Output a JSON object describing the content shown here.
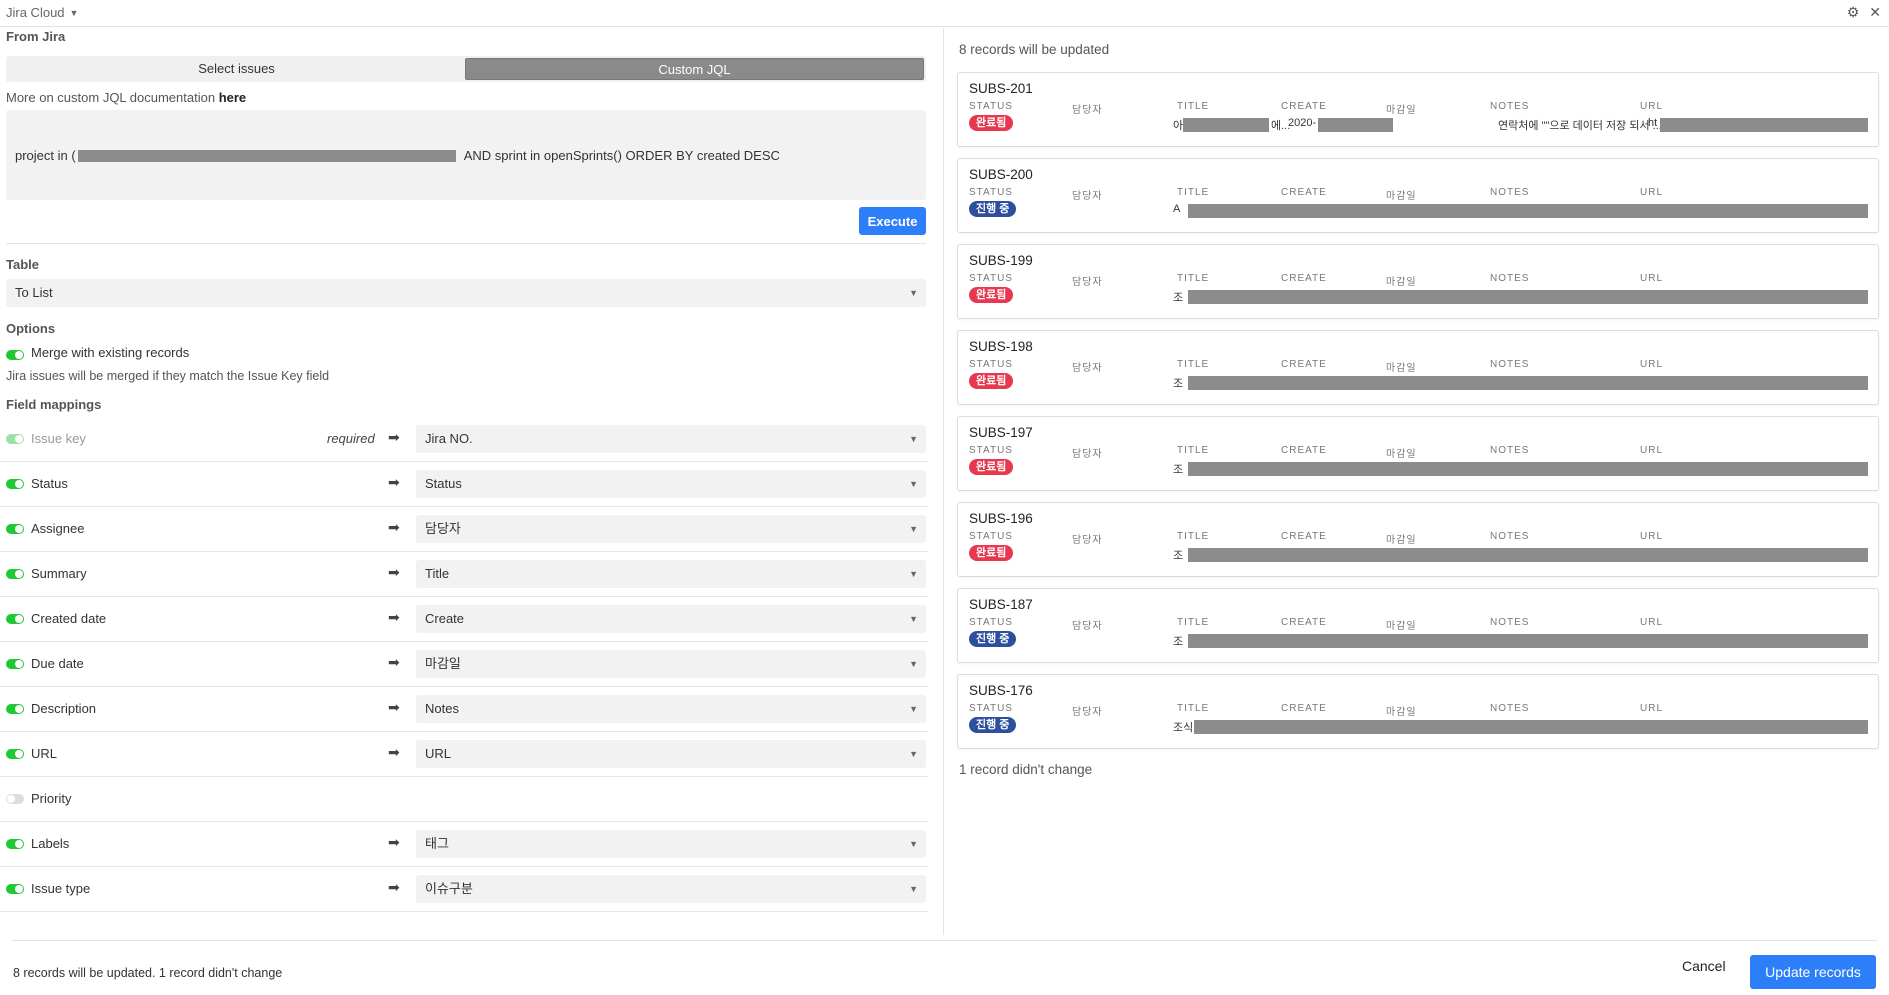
{
  "app": {
    "title": "Jira Cloud"
  },
  "left": {
    "from_label": "From Jira",
    "tabs": [
      "Select issues",
      "Custom JQL"
    ],
    "active_tab": 1,
    "doc_text": "More on custom JQL documentation ",
    "doc_link": "here",
    "jql_prefix": "project in (",
    "jql_suffix": "AND sprint in openSprints() ORDER BY created DESC",
    "execute_label": "Execute",
    "table_label": "Table",
    "table_value": "To List",
    "options_label": "Options",
    "merge_label": "Merge with existing records",
    "merge_hint": "Jira issues will be merged if they match the Issue Key field",
    "mappings_label": "Field mappings",
    "required_label": "required",
    "mappings": [
      {
        "field": "Issue key",
        "target": "Jira NO.",
        "enabled": true,
        "locked": true
      },
      {
        "field": "Status",
        "target": "Status",
        "enabled": true
      },
      {
        "field": "Assignee",
        "target": "담당자",
        "enabled": true
      },
      {
        "field": "Summary",
        "target": "Title",
        "enabled": true
      },
      {
        "field": "Created date",
        "target": "Create",
        "enabled": true
      },
      {
        "field": "Due date",
        "target": "마감일",
        "enabled": true
      },
      {
        "field": "Description",
        "target": "Notes",
        "enabled": true
      },
      {
        "field": "URL",
        "target": "URL",
        "enabled": true
      },
      {
        "field": "Priority",
        "target": "",
        "enabled": false
      },
      {
        "field": "Labels",
        "target": "태그",
        "enabled": true
      },
      {
        "field": "Issue type",
        "target": "이슈구분",
        "enabled": true
      }
    ]
  },
  "right": {
    "records_header": "8 records will be updated",
    "columns": [
      "STATUS",
      "담당자",
      "TITLE",
      "CREATE",
      "마감일",
      "NOTES",
      "URL"
    ],
    "status_colors": {
      "완료됨": "#e8384f",
      "진행 중": "#2d4f9e"
    },
    "records": [
      {
        "key": "SUBS-201",
        "status": "완료됨",
        "title_start": "아",
        "title_end": "에...",
        "create_start": "2020-",
        "notes": "연락처에 \"\"으로 데이터 저장 되서 ...",
        "url_start": "ht"
      },
      {
        "key": "SUBS-200",
        "status": "진행 중",
        "title_start": "A"
      },
      {
        "key": "SUBS-199",
        "status": "완료됨",
        "title_start": "조"
      },
      {
        "key": "SUBS-198",
        "status": "완료됨",
        "title_start": "조"
      },
      {
        "key": "SUBS-197",
        "status": "완료됨",
        "title_start": "조"
      },
      {
        "key": "SUBS-196",
        "status": "완료됨",
        "title_start": "조"
      },
      {
        "key": "SUBS-187",
        "status": "진행 중",
        "title_start": "조"
      },
      {
        "key": "SUBS-176",
        "status": "진행 중",
        "title_start": "조식"
      }
    ],
    "unchanged_text": "1 record didn't change"
  },
  "footer": {
    "summary": "8 records will be updated. 1 record didn't change",
    "cancel_label": "Cancel",
    "update_label": "Update records"
  },
  "colors": {
    "accent": "#2d7ff9",
    "toggle_on": "#20c933"
  }
}
